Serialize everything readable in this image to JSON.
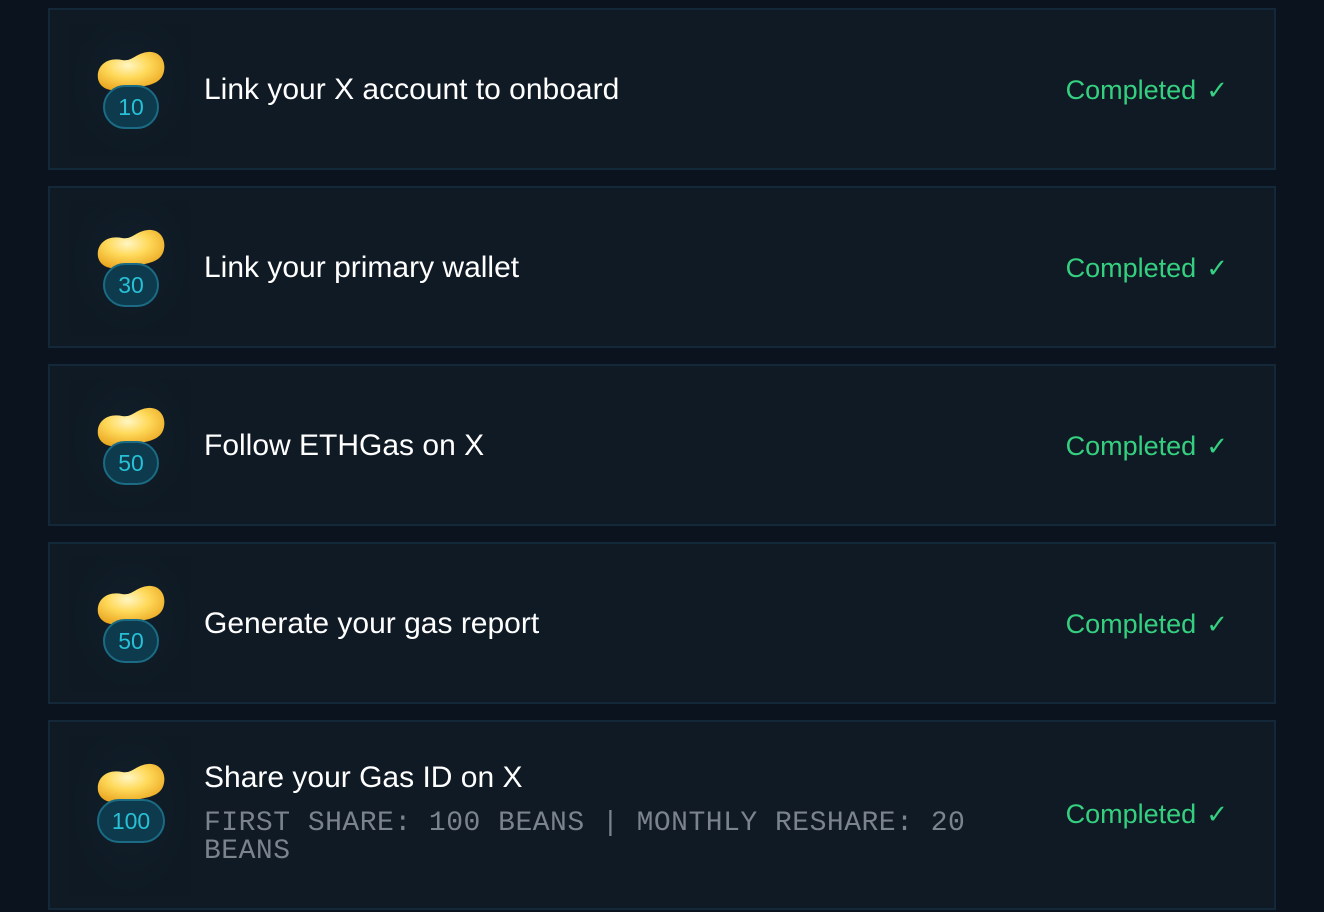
{
  "colors": {
    "background": "#0b141e",
    "card": "#0f1a25",
    "card_border": "#13293a",
    "completed": "#35d07f",
    "pill_text": "#27c0d6",
    "bean_gold": "#f5c94a"
  },
  "tasks": [
    {
      "reward": "10",
      "title": "Link your X account to onboard",
      "status": "Completed",
      "status_icon": "check-icon"
    },
    {
      "reward": "30",
      "title": "Link your primary wallet",
      "status": "Completed",
      "status_icon": "check-icon"
    },
    {
      "reward": "50",
      "title": "Follow ETHGas on X",
      "status": "Completed",
      "status_icon": "check-icon"
    },
    {
      "reward": "50",
      "title": "Generate your gas report",
      "status": "Completed",
      "status_icon": "check-icon"
    },
    {
      "reward": "100",
      "title": "Share your Gas ID on X",
      "subtitle": "FIRST SHARE: 100 BEANS | MONTHLY RESHARE: 20 BEANS",
      "status": "Completed",
      "status_icon": "check-icon"
    }
  ]
}
